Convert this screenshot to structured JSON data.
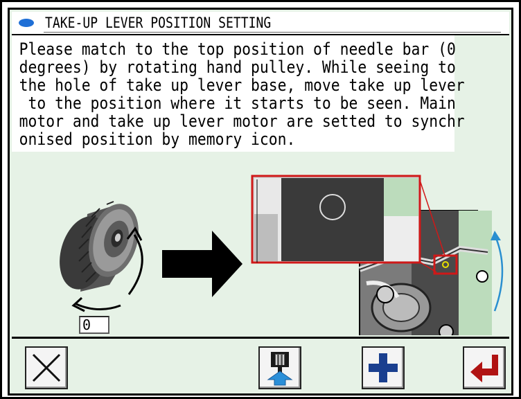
{
  "header": {
    "title": "TAKE-UP LEVER POSITION SETTING"
  },
  "instructions": {
    "lines": [
      "Please match to the top position of needle bar (0",
      "degrees) by rotating hand pulley. While seeing to",
      "the hole of take up lever base, move take up lever",
      " to the position where it starts to be seen. Main",
      "motor and take up lever motor are setted to synchr",
      "onised position by memory icon."
    ]
  },
  "angle_field": {
    "value": "0"
  },
  "toolbar": {
    "buttons": [
      {
        "icon": "close-x-icon"
      },
      {
        "icon": "thread-feed-icon"
      },
      {
        "icon": "plus-icon"
      },
      {
        "icon": "enter-memory-icon"
      }
    ]
  },
  "colors": {
    "screen_background": "#e6f2e6",
    "title_dot": "#1f6fd6",
    "plus": "#1a3f8f",
    "enter": "#b01313",
    "zoom_box": "#d01818",
    "rotation_arc": "#2a8fd0"
  }
}
